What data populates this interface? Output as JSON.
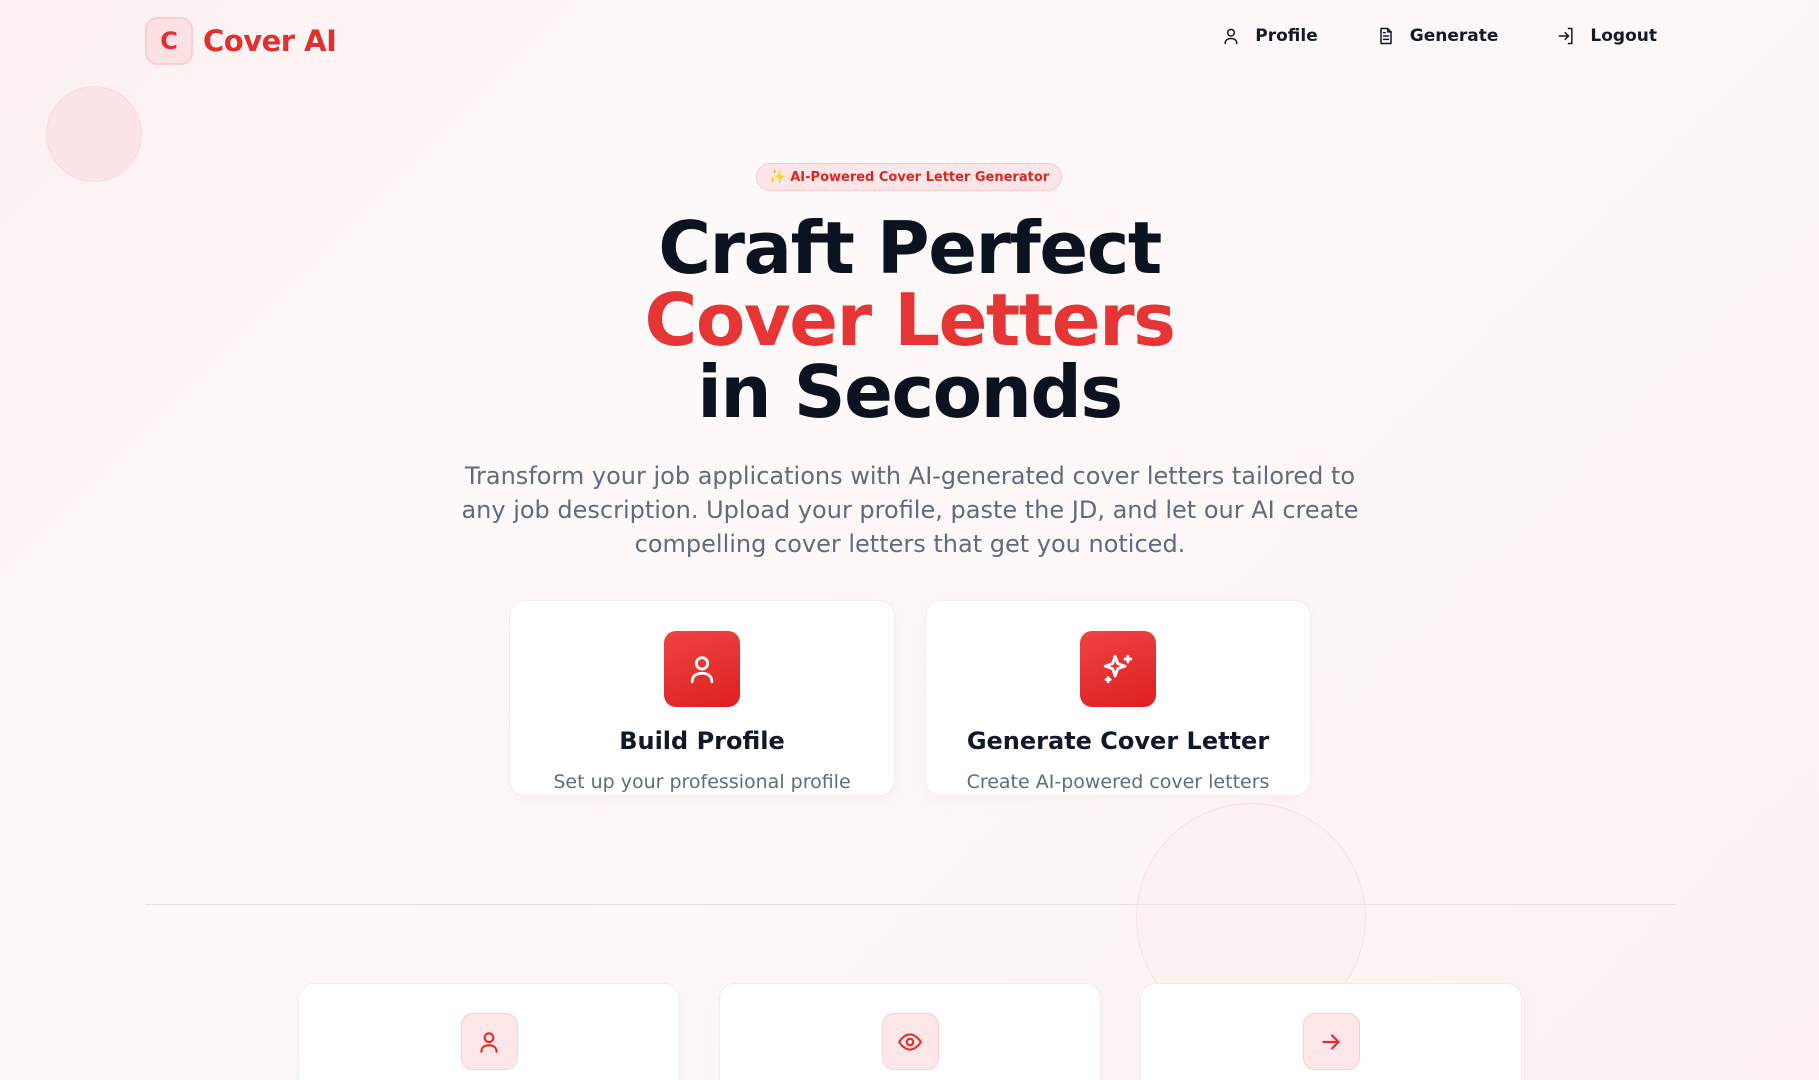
{
  "brand": {
    "logo_letter": "C",
    "name": "Cover AI"
  },
  "nav": {
    "items": [
      {
        "label": "Profile",
        "icon": "user-icon"
      },
      {
        "label": "Generate",
        "icon": "document-icon"
      },
      {
        "label": "Logout",
        "icon": "logout-icon"
      }
    ]
  },
  "hero": {
    "badge_icon": "sparkle-icon",
    "badge": "AI-Powered Cover Letter Generator",
    "title_line1": "Craft Perfect",
    "title_line2": "Cover Letters",
    "title_line3": "in Seconds",
    "subtitle": "Transform your job applications with AI-generated cover letters tailored to any job description. Upload your profile, paste the JD, and let our AI create compelling cover letters that get you noticed."
  },
  "action_cards": [
    {
      "icon": "user-icon",
      "title": "Build Profile",
      "description": "Set up your professional profile"
    },
    {
      "icon": "sparkles-icon",
      "title": "Generate Cover Letter",
      "description": "Create AI-powered cover letters"
    }
  ],
  "feature_cards": [
    {
      "icon": "user-icon"
    },
    {
      "icon": "eye-icon"
    },
    {
      "icon": "arrow-right-icon"
    }
  ],
  "colors": {
    "accent": "#e53535",
    "text_dark": "#0b1220",
    "text_muted": "#5f6b80",
    "badge_bg": "#fde6e7"
  }
}
